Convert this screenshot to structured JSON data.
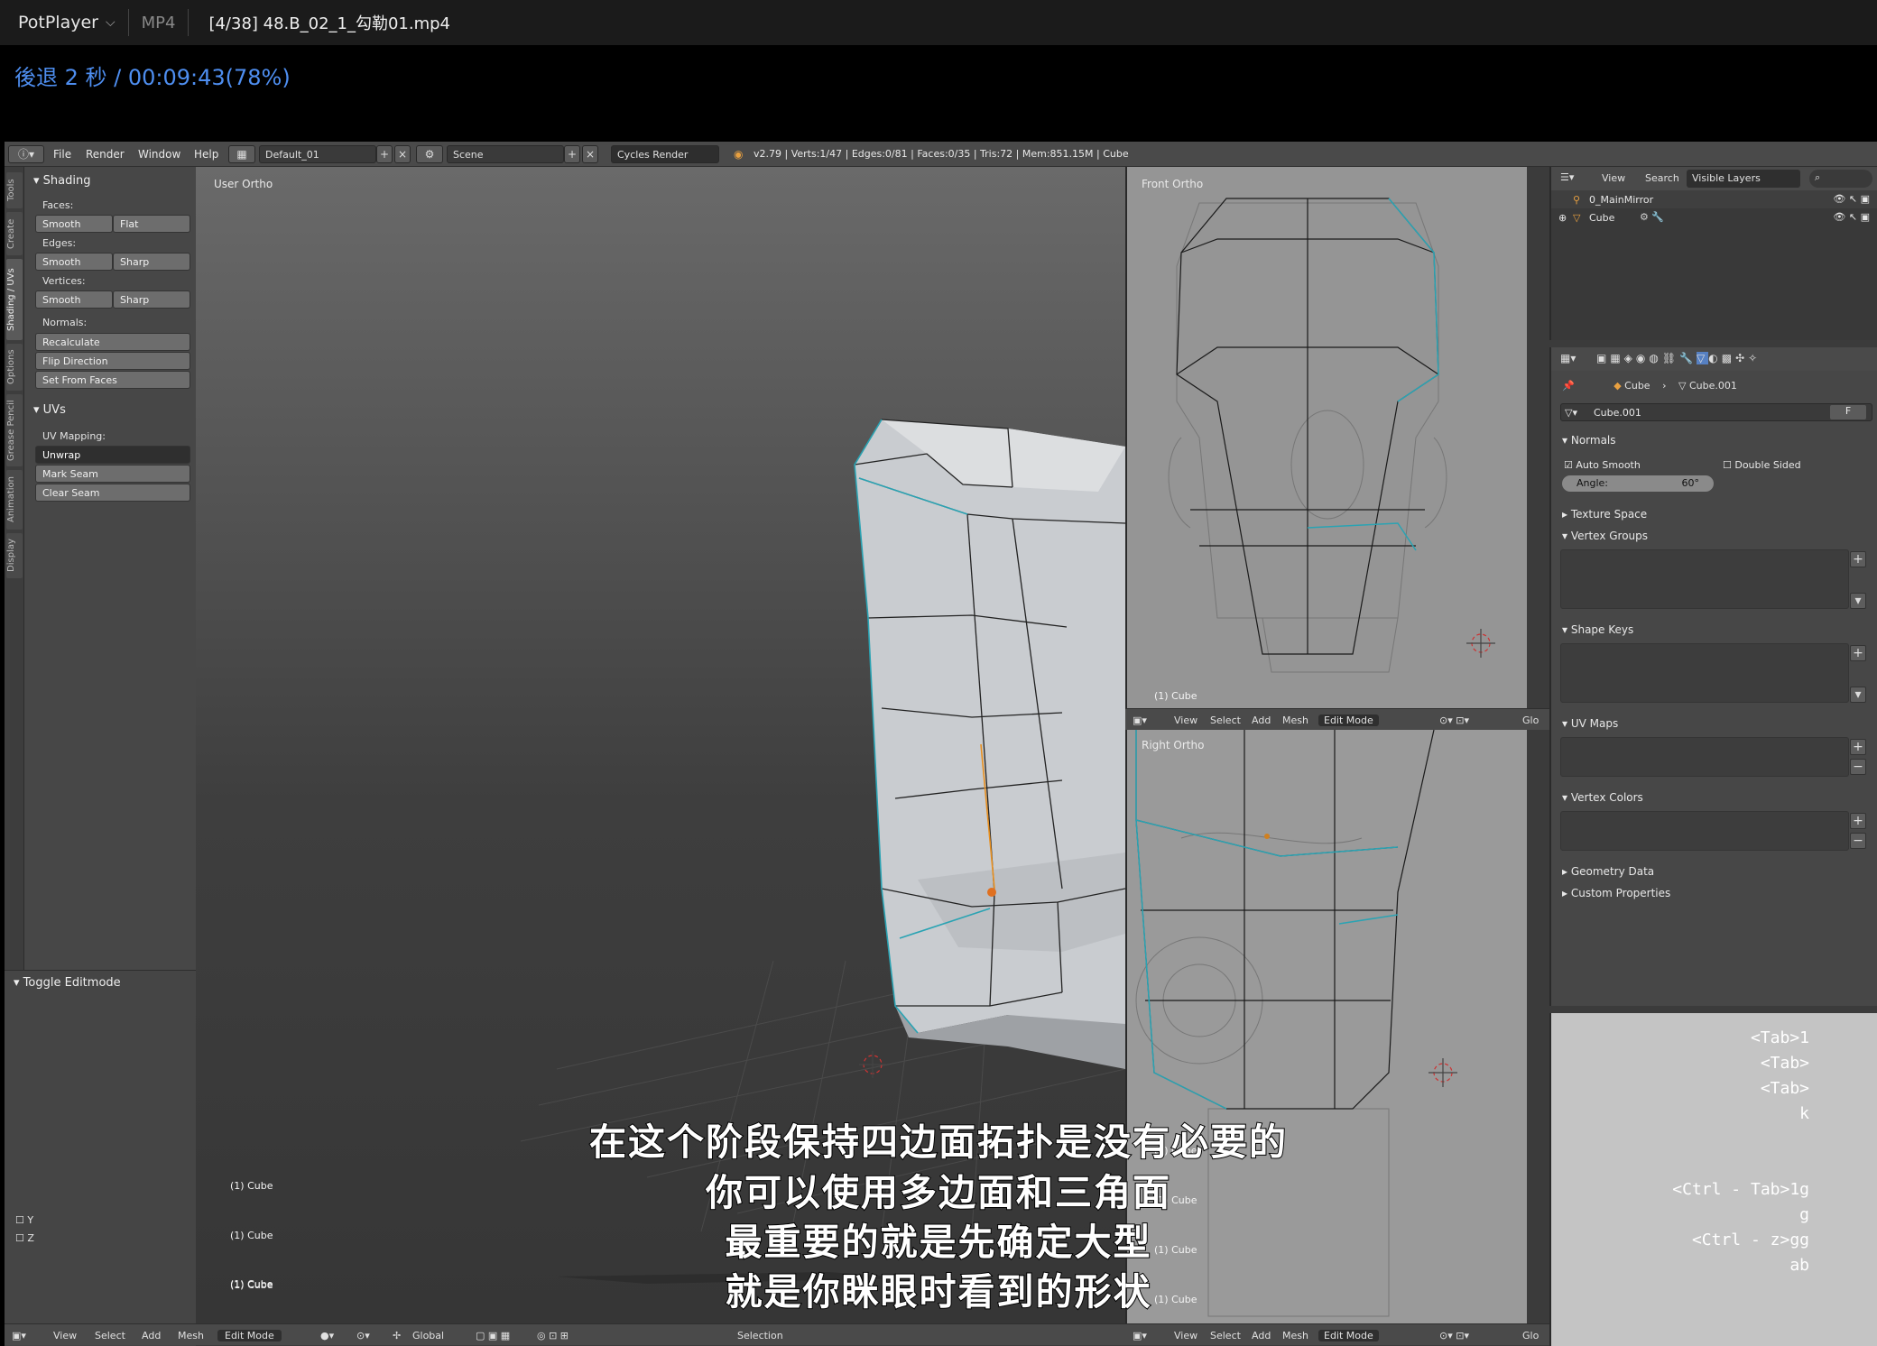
{
  "player": {
    "brand": "PotPlayer",
    "format": "MP4",
    "file": "[4/38] 48.B_02_1_勾勒01.mp4",
    "osd": "後退 2 秒 / 00:09:43(78%)"
  },
  "topbar": {
    "menus": [
      "File",
      "Render",
      "Window",
      "Help"
    ],
    "layout": "Default_01",
    "scene": "Scene",
    "engine": "Cycles Render",
    "stats": "v2.79 | Verts:1/47 | Edges:0/81 | Faces:0/35 | Tris:72 | Mem:851.15M | Cube"
  },
  "tooltabs": [
    "Tools",
    "Create",
    "Shading / UVs",
    "Options",
    "Grease Pencil",
    "Animation",
    "Display"
  ],
  "shading": {
    "title": "Shading",
    "faces_label": "Faces:",
    "faces": [
      "Smooth",
      "Flat"
    ],
    "edges_label": "Edges:",
    "edges": [
      "Smooth",
      "Sharp"
    ],
    "vertices_label": "Vertices:",
    "vertices": [
      "Smooth",
      "Sharp"
    ],
    "normals_label": "Normals:",
    "normals": [
      "Recalculate",
      "Flip Direction",
      "Set From Faces"
    ]
  },
  "uvs": {
    "title": "UVs",
    "mapping_label": "UV Mapping:",
    "unwrap": "Unwrap",
    "buttons": [
      "Mark Seam",
      "Clear Seam"
    ]
  },
  "operator": {
    "title": "Toggle Editmode",
    "axes": [
      "Y",
      "Z"
    ]
  },
  "viewport": {
    "main_label": "User Ortho",
    "front_label": "Front Ortho",
    "right_label": "Right Ortho",
    "object_label": "(1) Cube",
    "header": [
      "View",
      "Select",
      "Add",
      "Mesh"
    ],
    "mode": "Edit Mode",
    "orientation": "Global",
    "extra": "Selection",
    "glo": "Glo"
  },
  "outliner": {
    "menus": [
      "View",
      "Search"
    ],
    "filter": "Visible Layers",
    "items": [
      "0_MainMirror",
      "Cube"
    ]
  },
  "properties": {
    "breadcrumb": [
      "Cube",
      "Cube.001"
    ],
    "mesh_name": "Cube.001",
    "fake_user": "F",
    "normals": "Normals",
    "auto_smooth": "Auto Smooth",
    "double_sided": "Double Sided",
    "angle_label": "Angle:",
    "angle_value": "60°",
    "sections": [
      "Texture Space",
      "Vertex Groups",
      "Shape Keys",
      "UV Maps",
      "Vertex Colors",
      "Geometry Data",
      "Custom Properties"
    ]
  },
  "keys": [
    "<Tab>1",
    "<Tab>",
    "<Tab>",
    "k",
    "",
    "",
    "<Ctrl - Tab>1g",
    "g",
    "<Ctrl - z>gg",
    "ab"
  ],
  "subtitles": [
    "在这个阶段保持四边面拓扑是没有必要的",
    "你可以使用多边面和三角面",
    "最重要的就是先确定大型",
    "就是你眯眼时看到的形状"
  ]
}
